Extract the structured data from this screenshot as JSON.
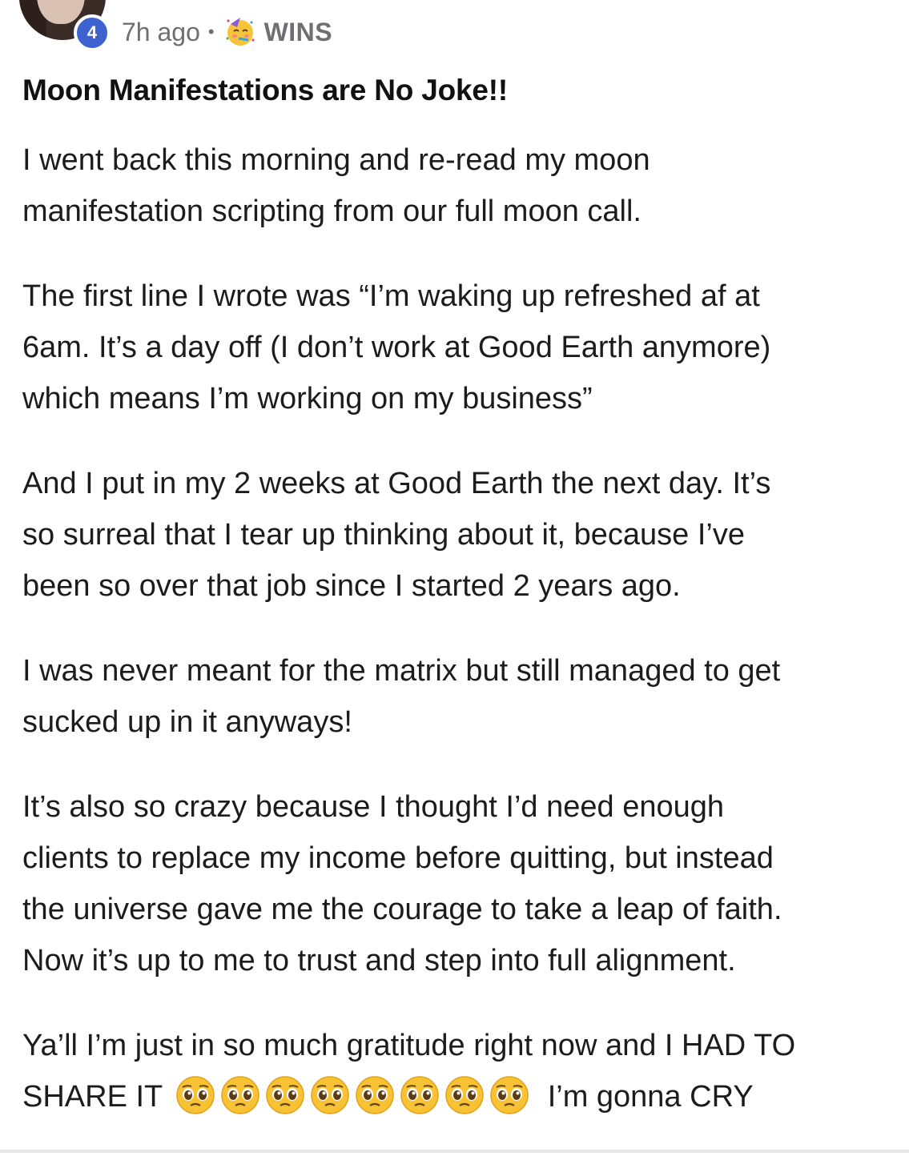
{
  "post": {
    "author_level": "4",
    "time_ago": "7h ago",
    "separator": "•",
    "category": "WINS",
    "category_icon": "partying-face-icon",
    "title": "Moon Manifestations are No Joke!!",
    "paragraphs": [
      {
        "lines": [
          "I went back this morning and re-read my moon",
          "manifestation scripting from our full moon call."
        ]
      },
      {
        "lines": [
          "The first line I wrote was “I’m waking up refreshed af at",
          "6am. It’s a day off (I don’t work at Good Earth anymore)",
          "which means I’m working on my business”"
        ]
      },
      {
        "lines": [
          "And I put in my 2 weeks at Good Earth the next day. It’s",
          "so surreal that I tear up thinking about it, because I’ve",
          "been so over that job since I started 2 years ago."
        ]
      },
      {
        "lines": [
          "I was never meant for the matrix but still managed to get",
          "sucked up in it anyways!"
        ]
      },
      {
        "lines": [
          "It’s also so crazy because I thought I’d need enough",
          "clients to replace my income before quitting, but instead",
          "the universe gave me the courage to take a leap of faith.",
          "Now it’s up to me to trust and step into full alignment."
        ]
      }
    ],
    "last_paragraph": {
      "line1": "Ya’ll I’m just in so much gratitude right now and I HAD TO",
      "line2_start": "SHARE IT",
      "emoji_icon": "pleading-face-icon",
      "emoji_count": 8,
      "line2_end": "I’m gonna CRY"
    }
  }
}
